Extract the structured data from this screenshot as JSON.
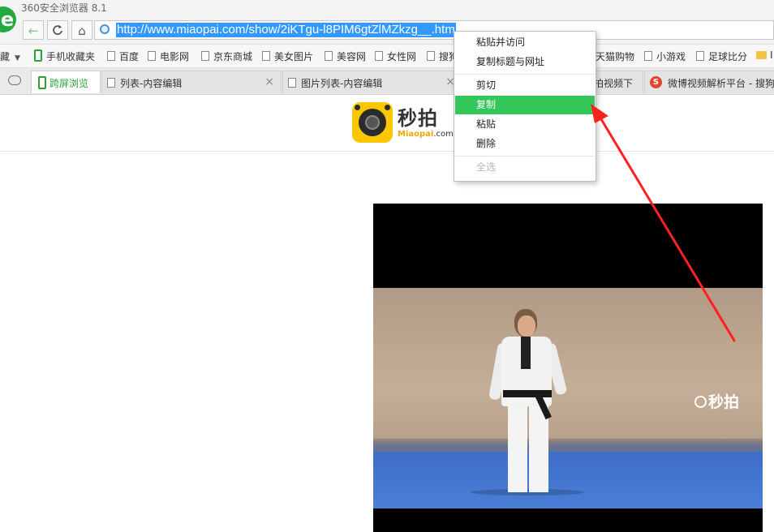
{
  "window": {
    "title": "360安全浏览器 8.1",
    "logo_glyph": "e"
  },
  "nav": {
    "back_icon": "←",
    "forward_icon": "C",
    "home_icon": "⌂",
    "url": "http://www.miaopai.com/show/2iKTgu-l8PIM6gtZlMZkzg__.htm"
  },
  "bookmarks": {
    "items": [
      {
        "label": "藏",
        "icon": "none"
      },
      {
        "label": "手机收藏夹",
        "icon": "phone-icon"
      },
      {
        "label": "百度",
        "icon": "page-icon"
      },
      {
        "label": "电影网",
        "icon": "page-icon"
      },
      {
        "label": "京东商城",
        "icon": "page-icon"
      },
      {
        "label": "美女图片",
        "icon": "page-icon"
      },
      {
        "label": "美容网",
        "icon": "page-icon"
      },
      {
        "label": "女性网",
        "icon": "page-icon"
      },
      {
        "label": "搜狗",
        "icon": "page-icon"
      },
      {
        "label": "天猫购物",
        "icon": "none"
      },
      {
        "label": "小游戏",
        "icon": "page-icon"
      },
      {
        "label": "足球比分",
        "icon": "page-icon"
      },
      {
        "label": "I",
        "icon": "folder-icon"
      }
    ]
  },
  "tabs": [
    {
      "label": "跨屏浏览",
      "active": true
    },
    {
      "label": "列表-内容编辑",
      "active": false
    },
    {
      "label": "图片列表-内容编辑",
      "active": false
    },
    {
      "label": "拍视频下",
      "active": false
    },
    {
      "label": "微博视频解析平台 - 搜狗",
      "active": false
    }
  ],
  "page": {
    "logo_cn": "秒拍",
    "logo_en_prefix": "Miaopai",
    "logo_en_suffix": ".com",
    "video_watermark": "秒拍"
  },
  "context_menu": {
    "items": [
      {
        "label": "粘贴并访问",
        "state": "normal"
      },
      {
        "label": "复制标题与网址",
        "state": "normal"
      },
      {
        "label": "剪切",
        "state": "normal"
      },
      {
        "label": "复制",
        "state": "highlighted"
      },
      {
        "label": "粘贴",
        "state": "normal"
      },
      {
        "label": "删除",
        "state": "normal"
      },
      {
        "label": "全选",
        "state": "disabled"
      }
    ]
  },
  "colors": {
    "highlight": "#34c759",
    "url_selection": "#3399ff",
    "arrow": "#ff2020",
    "brand_yellow": "#fbc700"
  }
}
